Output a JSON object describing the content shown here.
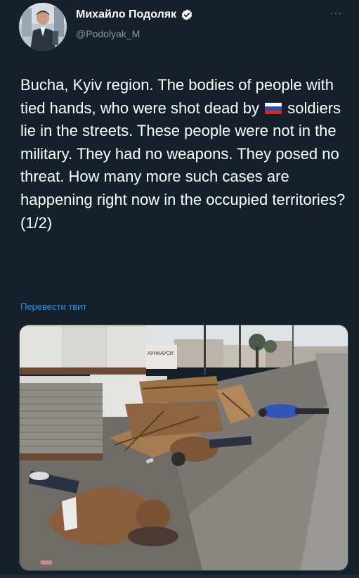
{
  "author": {
    "display_name": "Михайло Подоляк",
    "handle": "@Podolyak_M",
    "verified": true
  },
  "tweet": {
    "text_before_flag": "Bucha, Kyiv region. The bodies of people with tied hands, who were shot dead by ",
    "flag_icon": "russia-flag",
    "text_after_flag": " soldiers lie in the streets. These people were not in the military. They had no weapons. They posed no threat. How many more such cases are happening right now in the occupied territories? (1/2)"
  },
  "translate_label": "Перевести твит",
  "more_label": "···",
  "media": {
    "sign_text": "АУНКАУСИ"
  },
  "colors": {
    "background": "#15202b",
    "text": "#ffffff",
    "secondary": "#8899a6",
    "link": "#1d9bf0",
    "verified": "#ffffff"
  }
}
